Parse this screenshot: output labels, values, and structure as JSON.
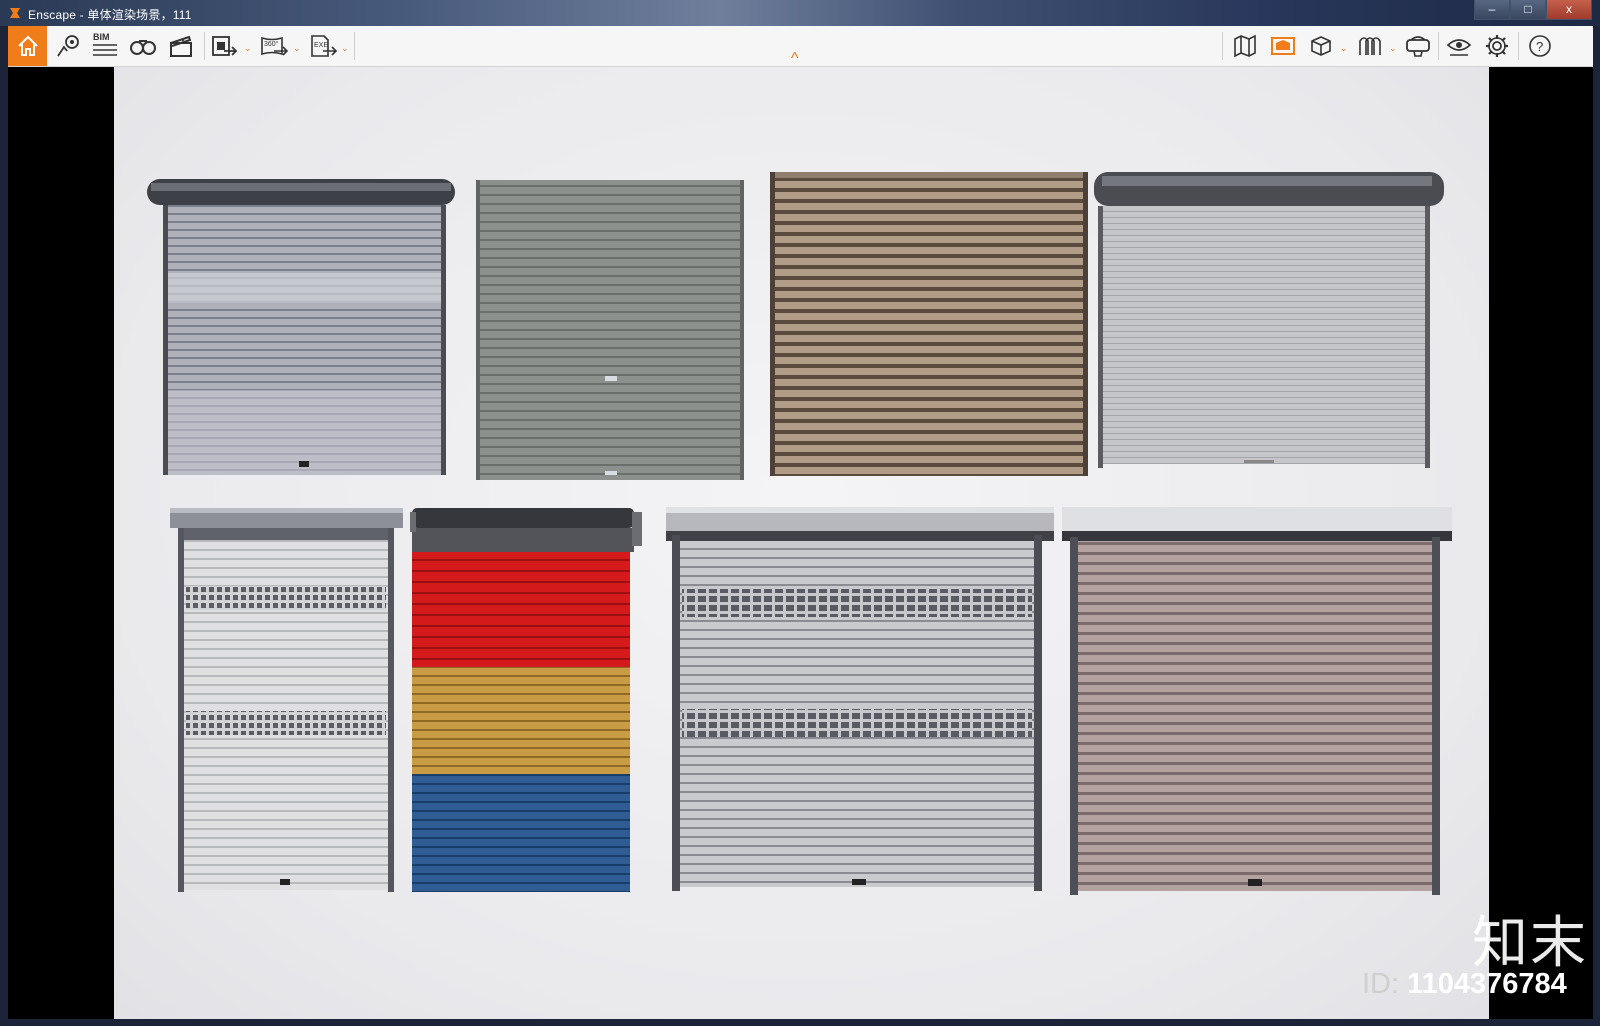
{
  "window": {
    "title": "Enscape - 单体渲染场景，111",
    "controls": {
      "minimize": "–",
      "maximize": "□",
      "close": "x"
    }
  },
  "toolbar": {
    "left_tools": [
      {
        "name": "home-icon"
      },
      {
        "name": "views-icon"
      },
      {
        "name": "bim-icon",
        "text": "BIM"
      },
      {
        "name": "binoculars-icon"
      },
      {
        "name": "clapperboard-icon"
      },
      {
        "name": "screenshot-icon"
      },
      {
        "name": "panorama-icon",
        "text": "360°"
      },
      {
        "name": "export-exe-icon",
        "text": "EXE"
      }
    ],
    "right_tools": [
      {
        "name": "map-icon"
      },
      {
        "name": "asset-library-icon"
      },
      {
        "name": "cube-icon"
      },
      {
        "name": "materials-icon"
      },
      {
        "name": "vr-headset-icon"
      },
      {
        "name": "eye-icon"
      },
      {
        "name": "settings-gear-icon"
      },
      {
        "name": "help-icon"
      }
    ],
    "collapse_glyph": "^",
    "accent_color": "#f07d1a"
  },
  "scene": {
    "description_items": [
      {
        "name": "shutter-1",
        "style": "dark grey roller shutter with round housing"
      },
      {
        "name": "shutter-2",
        "style": "grey-green roller shutter without housing"
      },
      {
        "name": "shutter-3",
        "style": "bronze/brown slatted shutter"
      },
      {
        "name": "shutter-4",
        "style": "light grey shutter with round housing"
      },
      {
        "name": "shutter-5",
        "style": "white shutter with perforated bands"
      },
      {
        "name": "shutter-6",
        "style": "red, yellow, blue striped shutter"
      },
      {
        "name": "shutter-7",
        "style": "silver shutter with perforated bands"
      },
      {
        "name": "shutter-8",
        "style": "mauve slatted shutter with box housing"
      }
    ]
  },
  "watermark": {
    "logo_text": "知末",
    "id_prefix": "ID:",
    "id_number": "1104376784"
  }
}
